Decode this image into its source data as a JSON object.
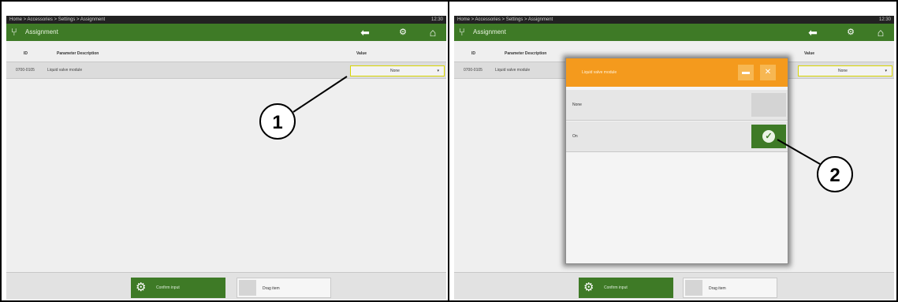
{
  "screens": [
    {
      "breadcrumb": "Home > Accessories > Settings > Assignment",
      "time": "12:30",
      "app_title": "Assignment",
      "icons": [
        "back-arrow-icon",
        "settings-icon",
        "home-icon"
      ],
      "table": {
        "headers": [
          "ID",
          "Parameter Description",
          "Value"
        ],
        "rows": [
          {
            "id": "0700-0105",
            "description": "Liquid valve module",
            "value": "None"
          }
        ]
      },
      "footer": {
        "primary_label": "Confirm input",
        "secondary_label": "Drag item"
      }
    },
    {
      "breadcrumb": "Home > Accessories > Settings > Assignment",
      "time": "12:30",
      "app_title": "Assignment",
      "icons": [
        "back-arrow-icon",
        "settings-icon",
        "home-icon"
      ],
      "table": {
        "headers": [
          "ID",
          "Parameter Description",
          "Value"
        ],
        "rows": [
          {
            "id": "0700-0105",
            "description": "Liquid valve module",
            "value": "None"
          }
        ]
      },
      "dialog": {
        "title": "Liquid valve module",
        "options": [
          {
            "label": "None",
            "checked": false
          },
          {
            "label": "On",
            "checked": true
          }
        ]
      },
      "footer": {
        "primary_label": "Confirm input",
        "secondary_label": "Drag item"
      }
    }
  ],
  "callouts": [
    "1",
    "2"
  ],
  "colors": {
    "accent_green": "#3e7a26",
    "dialog_orange": "#f49a1d",
    "highlight_yellow": "#d8d600"
  }
}
